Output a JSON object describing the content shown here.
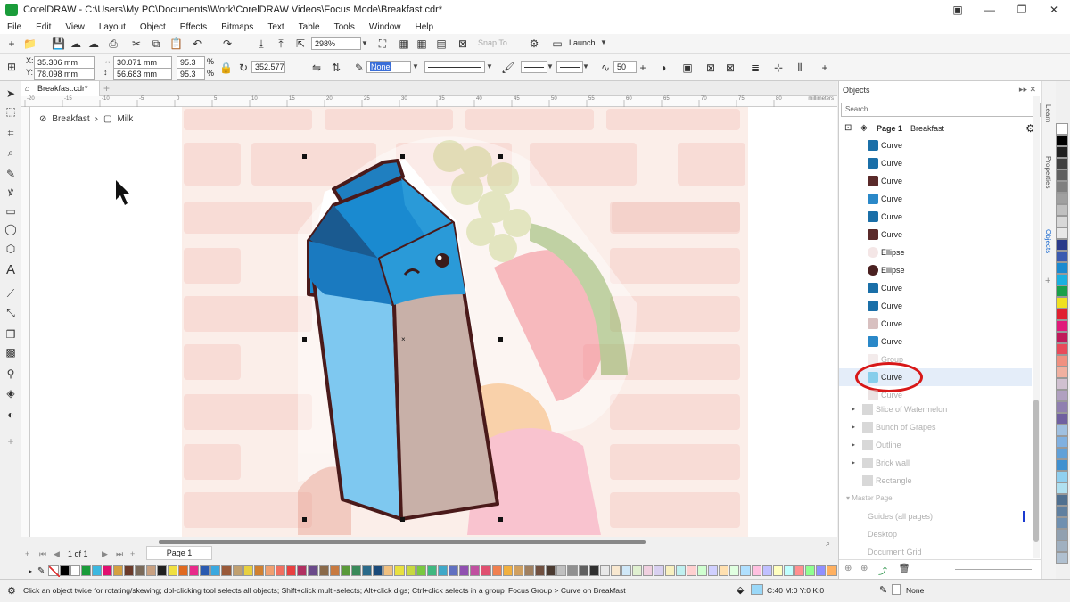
{
  "window": {
    "title": "CorelDRAW - C:\\Users\\My PC\\Documents\\Work\\CorelDRAW Videos\\Focus Mode\\Breakfast.cdr*"
  },
  "menu": [
    "File",
    "Edit",
    "View",
    "Layout",
    "Object",
    "Effects",
    "Bitmaps",
    "Text",
    "Table",
    "Tools",
    "Window",
    "Help"
  ],
  "toolbar": {
    "zoom": "298%",
    "snap_to": "Snap To",
    "launch": "Launch"
  },
  "propertybar": {
    "x": "35.306 mm",
    "y": "78.098 mm",
    "w": "30.071 mm",
    "h": "56.683 mm",
    "scale_x": "95.3",
    "scale_y": "95.3",
    "pct": "%",
    "rotation": "352.577",
    "fill": "None",
    "smooth": "50"
  },
  "document": {
    "tab_label": "Breakfast.cdr*",
    "breadcrumb_root": "Breakfast",
    "breadcrumb_child": "Milk",
    "ruler_unit": "millimeters",
    "ruler_ticks": [
      "-20",
      "-15",
      "-10",
      "-5",
      "0",
      "5",
      "10",
      "15",
      "20",
      "25",
      "30",
      "35",
      "40",
      "45",
      "50",
      "55",
      "60",
      "65",
      "70",
      "75",
      "80"
    ]
  },
  "pager": {
    "page_of": "1 of 1",
    "page_tab": "Page 1"
  },
  "objects_panel": {
    "title": "Objects",
    "search_placeholder": "Search",
    "page_label": "Page 1",
    "page_layer": "Breakfast",
    "items": [
      {
        "label": "Curve",
        "color": "#1a6fa8",
        "faded": false,
        "selected": false
      },
      {
        "label": "Curve",
        "color": "#1a6fa8",
        "faded": false,
        "selected": false
      },
      {
        "label": "Curve",
        "color": "#5a2a2a",
        "faded": false,
        "selected": false
      },
      {
        "label": "Curve",
        "color": "#2a88c8",
        "faded": false,
        "selected": false
      },
      {
        "label": "Curve",
        "color": "#1a6fa8",
        "faded": false,
        "selected": false
      },
      {
        "label": "Curve",
        "color": "#5a2a2a",
        "faded": false,
        "selected": false
      },
      {
        "label": "Ellipse",
        "color": "#f4e6e6",
        "faded": false,
        "selected": false
      },
      {
        "label": "Ellipse",
        "color": "#4a2020",
        "faded": false,
        "selected": false
      },
      {
        "label": "Curve",
        "color": "#1a6fa8",
        "faded": false,
        "selected": false
      },
      {
        "label": "Curve",
        "color": "#1a6fa8",
        "faded": false,
        "selected": false
      },
      {
        "label": "Curve",
        "color": "#d8c0c0",
        "faded": false,
        "selected": false
      },
      {
        "label": "Curve",
        "color": "#2a88c8",
        "faded": false,
        "selected": false
      },
      {
        "label": "Group",
        "color": "#e8d8d8",
        "faded": true,
        "selected": false
      },
      {
        "label": "Curve",
        "color": "#87ceeb",
        "faded": false,
        "selected": true
      },
      {
        "label": "Curve",
        "color": "#d8c8c8",
        "faded": true,
        "selected": false
      }
    ],
    "groups": [
      {
        "label": "Slice of Watermelon"
      },
      {
        "label": "Bunch of Grapes"
      },
      {
        "label": "Outline"
      },
      {
        "label": "Brick wall"
      },
      {
        "label": "Rectangle"
      }
    ],
    "master_page": "Master Page",
    "master_items": [
      "Guides (all pages)",
      "Desktop",
      "Document Grid"
    ]
  },
  "side_tabs": [
    "Learn",
    "Properties",
    "Objects"
  ],
  "status": {
    "hint": "Click an object twice for rotating/skewing; dbl-clicking tool selects all objects; Shift+click multi-selects; Alt+click digs; Ctrl+click selects in a group",
    "focus": "Focus Group > Curve on Breakfast",
    "fill_color_text": "C:40 M:0 Y:0 K:0",
    "outline_text": "None"
  },
  "palette_colors": [
    "#000000",
    "#ffffff",
    "#1a9c3a",
    "#3cb8e0",
    "#e01070",
    "#d4a040",
    "#6a3a2a",
    "#7a6a5a",
    "#c8a080",
    "#202020",
    "#f0e040",
    "#e06a20",
    "#e82a8a",
    "#2a5ab0",
    "#3aa8e0",
    "#9a5a3a",
    "#c0a070",
    "#e8d040",
    "#d08030",
    "#f0a070",
    "#f07060",
    "#e84040",
    "#b03060",
    "#6a4a8a",
    "#8a6a4a",
    "#c87a40",
    "#5a9a3a",
    "#3a8a5a",
    "#2a6a8a",
    "#1a4a7a",
    "#f0c080",
    "#e8e040",
    "#c8d840",
    "#7ac840",
    "#40b880",
    "#40a8c8",
    "#6070c0",
    "#9050b0",
    "#c050a0",
    "#e05070",
    "#f08050",
    "#f0b040",
    "#d0a060",
    "#a08060",
    "#705040",
    "#4a3a30",
    "#c0c0c0",
    "#909090",
    "#606060",
    "#303030",
    "#e8e8e8",
    "#f8e8d0",
    "#d0e8f8",
    "#e0f0d0",
    "#f0d0e0",
    "#d8d0f0",
    "#f8f0c0",
    "#c0f0f0",
    "#ffd0d0",
    "#d0ffd0",
    "#d0d0ff",
    "#ffe0b0",
    "#e0ffe0",
    "#b0e0ff",
    "#ffc0e0",
    "#c0c0ff",
    "#ffffc0",
    "#c0ffff",
    "#ff9090",
    "#90ff90",
    "#9090ff",
    "#ffb060"
  ],
  "vpalette_colors": [
    "#ffffff",
    "#000000",
    "#202020",
    "#404040",
    "#606060",
    "#808080",
    "#a0a0a0",
    "#c0c0c0",
    "#d8d8d8",
    "#e8e8e8",
    "#2a3a8a",
    "#3a5ab0",
    "#1a8ad0",
    "#1ab0e0",
    "#1aa04a",
    "#f0e020",
    "#e02030",
    "#e01a7a",
    "#c01a5a",
    "#e84a5a",
    "#f09080",
    "#f0b0a0",
    "#d0c0d0",
    "#b0a0c0",
    "#9080b0",
    "#7060a0",
    "#a0c0e0",
    "#80b0e0",
    "#60a0d8",
    "#4090d0",
    "#90d0f0",
    "#b0e0f0",
    "#507090",
    "#6080a0",
    "#7090b0",
    "#90a0b0",
    "#a0b0c0",
    "#b0c0d0"
  ]
}
